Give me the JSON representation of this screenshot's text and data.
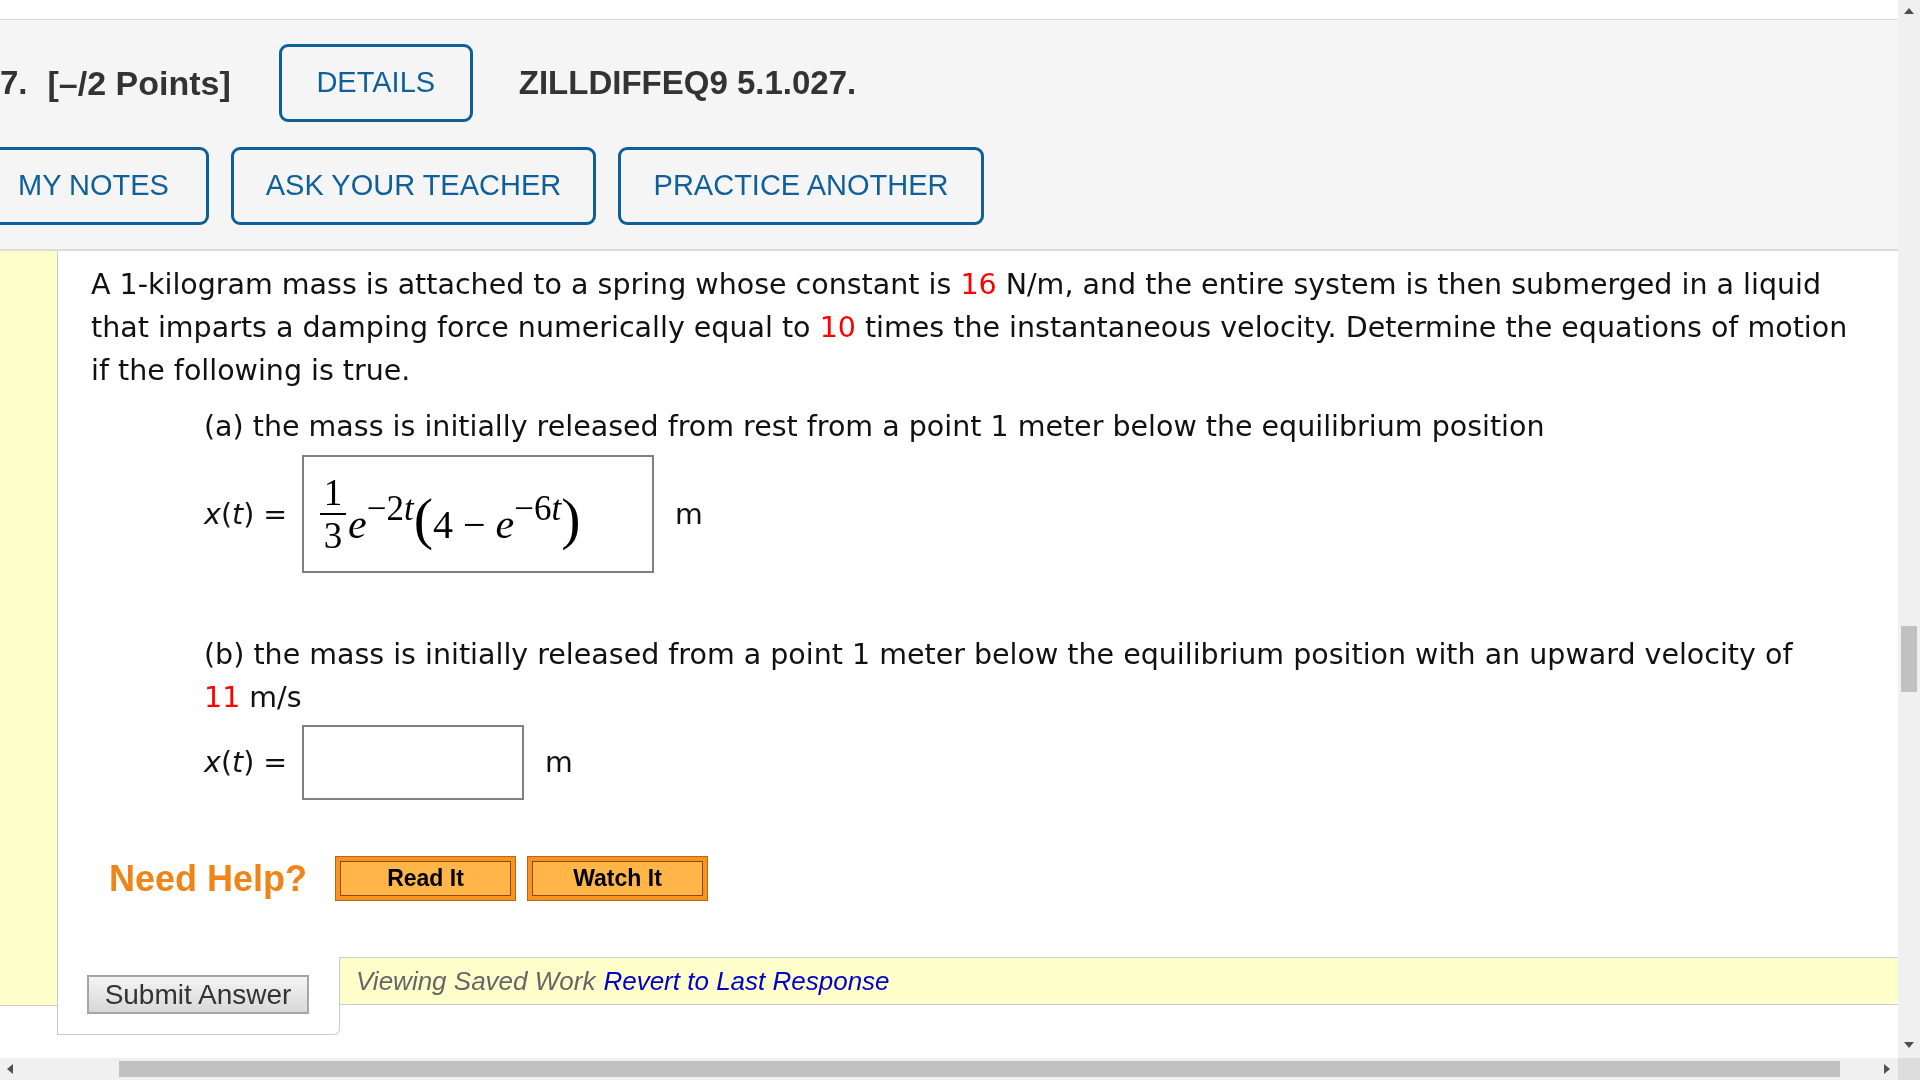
{
  "header": {
    "number": "7.",
    "points": "[–/2 Points]",
    "details_button": "DETAILS",
    "problem_id": "ZILLDIFFEQ9 5.1.027.",
    "buttons": [
      "MY NOTES",
      "ASK YOUR TEACHER",
      "PRACTICE ANOTHER"
    ]
  },
  "question": {
    "intro": [
      {
        "text": "A 1-kilogram mass is attached to a spring whose constant is ",
        "highlight": false
      },
      {
        "text": "16",
        "highlight": true
      },
      {
        "text": " N/m, and the entire system is then submerged in a liquid that imparts a damping force numerically equal to ",
        "highlight": false
      },
      {
        "text": "10",
        "highlight": true
      },
      {
        "text": " times the instantaneous velocity. Determine the equations of motion if the following is true.",
        "highlight": false
      }
    ],
    "parts": [
      {
        "prompt": [
          {
            "text": "(a) the mass is initially released from rest from a point 1 meter below the equilibrium position",
            "highlight": false
          }
        ],
        "answer_label": "*x*(*t*) =",
        "answer_value": [
          {
            "kind": "frac",
            "numerator": "1",
            "denominator": "3"
          },
          {
            "kind": "var",
            "text": "e"
          },
          {
            "kind": "sup",
            "number": "−2",
            "variable": "t"
          },
          {
            "kind": "paren",
            "text": "("
          },
          {
            "kind": "num",
            "text": "4 − "
          },
          {
            "kind": "var",
            "text": "e"
          },
          {
            "kind": "sup",
            "number": "−6",
            "variable": "t"
          },
          {
            "kind": "paren",
            "text": ")"
          }
        ],
        "unit": "m"
      },
      {
        "prompt": [
          {
            "text": "(b) the mass is initially released from a point 1 meter below the equilibrium position with an upward velocity of ",
            "highlight": false
          },
          {
            "text": "11",
            "highlight": true
          },
          {
            "text": " m/s",
            "highlight": false
          }
        ],
        "answer_label": "*x*(*t*) =",
        "unit": "m"
      }
    ]
  },
  "help": {
    "label": "Need Help?",
    "buttons": [
      "Read It",
      "Watch It"
    ]
  },
  "submit_button": "Submit Answer",
  "saved_work": {
    "text": "Viewing Saved Work",
    "link": "Revert to Last Response"
  }
}
